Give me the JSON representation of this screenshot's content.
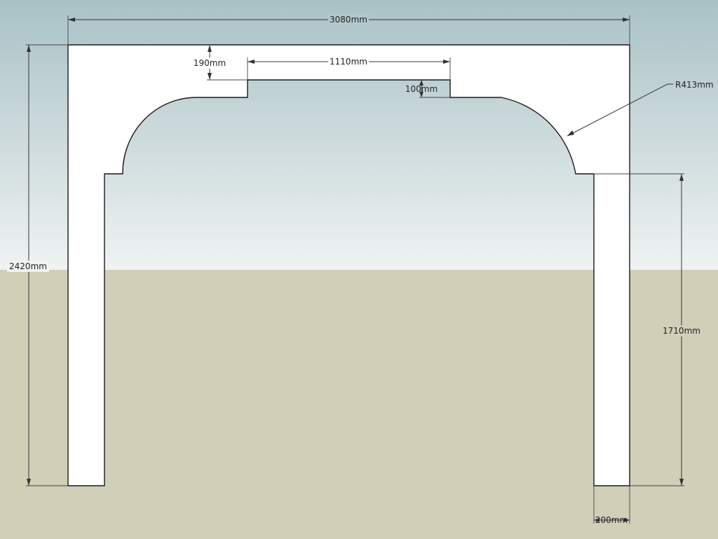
{
  "scene": {
    "sky_top_color": "#a9c1c6",
    "sky_bottom_color": "#eff3f2",
    "ground_color": "#d1cfb8",
    "arch_fill_color": "#ffffff",
    "outline_color": "#1a1a1a"
  },
  "dimensions": {
    "overall_width": "3080mm",
    "overall_height": "2420mm",
    "top_beam_depth": "190mm",
    "center_recess_width": "1110mm",
    "center_recess_depth": "100mm",
    "arch_radius": "R413mm",
    "opening_height": "1710mm",
    "leg_width": "200mm"
  }
}
